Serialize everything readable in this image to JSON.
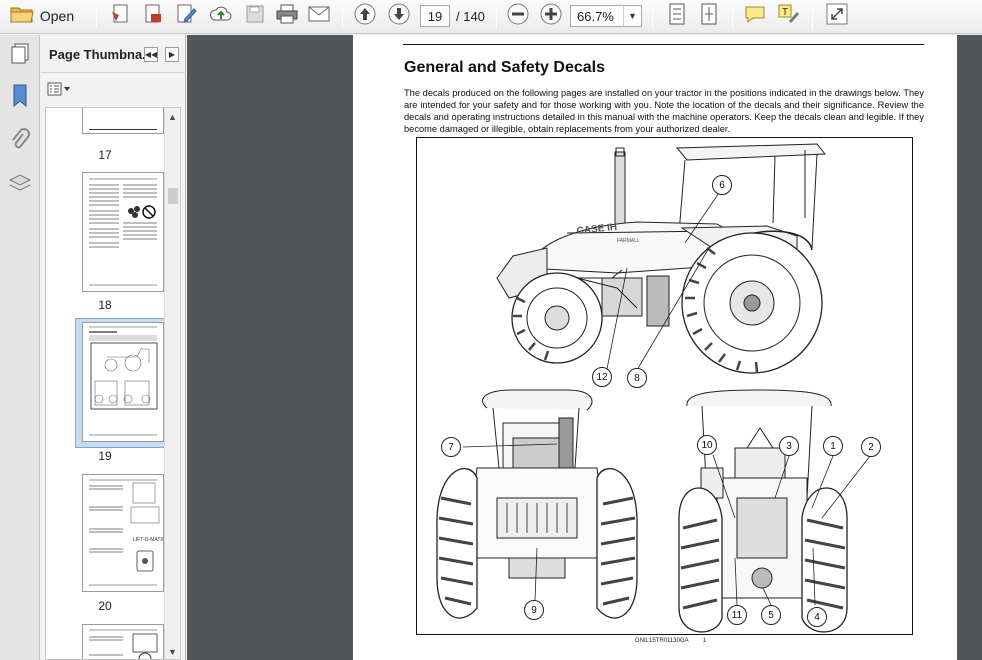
{
  "toolbar": {
    "open_label": "Open",
    "current_page": "19",
    "total_pages": "/ 140",
    "zoom": "66.7%"
  },
  "panel": {
    "title": "Page Thumbna...",
    "thumbnails": [
      {
        "page": "17"
      },
      {
        "page": "18"
      },
      {
        "page": "19",
        "selected": true
      },
      {
        "page": "20"
      }
    ]
  },
  "document": {
    "title": "General and Safety Decals",
    "body": "The decals produced on the following pages are installed on your tractor in the positions indicated in the drawings below.  They are intended for your safety and for those working with you.  Note the location of the decals and their significance.  Review the decals and operating instructions detailed in this manual with the machine operators. Keep the decals clean and legible.  If they become damaged or illegible, obtain replacements from your authorized dealer.",
    "callouts": {
      "c6": "6",
      "c12": "12",
      "c8": "8",
      "c7": "7",
      "c9": "9",
      "c10": "10",
      "c3": "3",
      "c1": "1",
      "c2": "2",
      "c11": "11",
      "c5": "5",
      "c4": "4"
    },
    "brand_mark": "CASE IH",
    "model_mark": "FARMALL",
    "caption_code": "GNIL15TR01130GA",
    "caption_num": "1"
  },
  "colors": {
    "toolbar_bg": "#f3f3f3",
    "doc_bg": "#525659",
    "selection": "#c7dcf2"
  }
}
